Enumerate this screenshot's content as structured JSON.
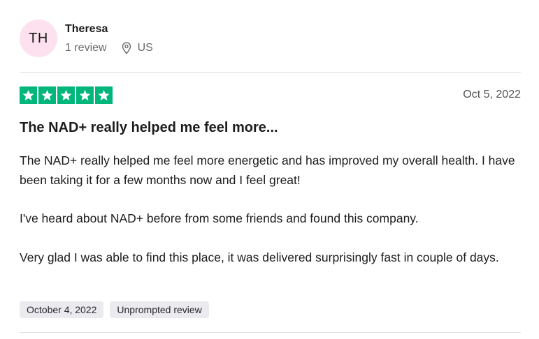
{
  "reviewer": {
    "initials": "TH",
    "name": "Theresa",
    "review_count": "1 review",
    "location_icon": "location-pin-icon",
    "country": "US",
    "avatar_color": "#fde1ee"
  },
  "review": {
    "rating": 5,
    "rating_max": 5,
    "star_color": "#00b67a",
    "date": "Oct 5, 2022",
    "title": "The NAD+ really helped me feel more...",
    "paragraphs": [
      "The NAD+ really helped me feel more energetic and has improved my overall health. I have been taking it for a few months now and I feel great!",
      "I've heard about NAD+ before from some friends and found this company.",
      "Very glad I was able to find this place, it was delivered surprisingly fast in couple of days."
    ],
    "experience_date": "October 4, 2022",
    "review_type": "Unprompted review"
  }
}
